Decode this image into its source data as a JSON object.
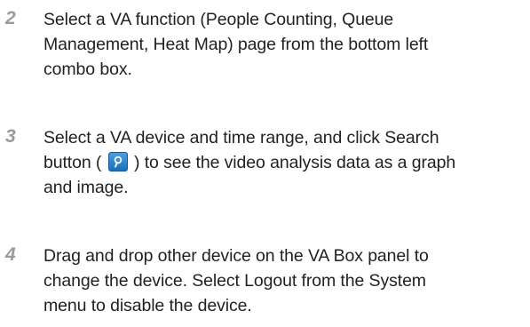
{
  "steps": [
    {
      "number": "2",
      "lines": [
        "Select a VA function (People Counting, Queue",
        "Management, Heat Map) page from the bottom left",
        "combo box."
      ]
    },
    {
      "number": "3",
      "lines": [
        "Select a VA device and time range, and click Search",
        "button (",
        ") to see the video analysis data as a graph",
        "and image."
      ],
      "icon": "search-icon"
    },
    {
      "number": "4",
      "lines": [
        "Drag and drop other device on the VA Box panel to",
        "change the device. Select Logout from the System",
        "menu to disable the device."
      ]
    }
  ]
}
